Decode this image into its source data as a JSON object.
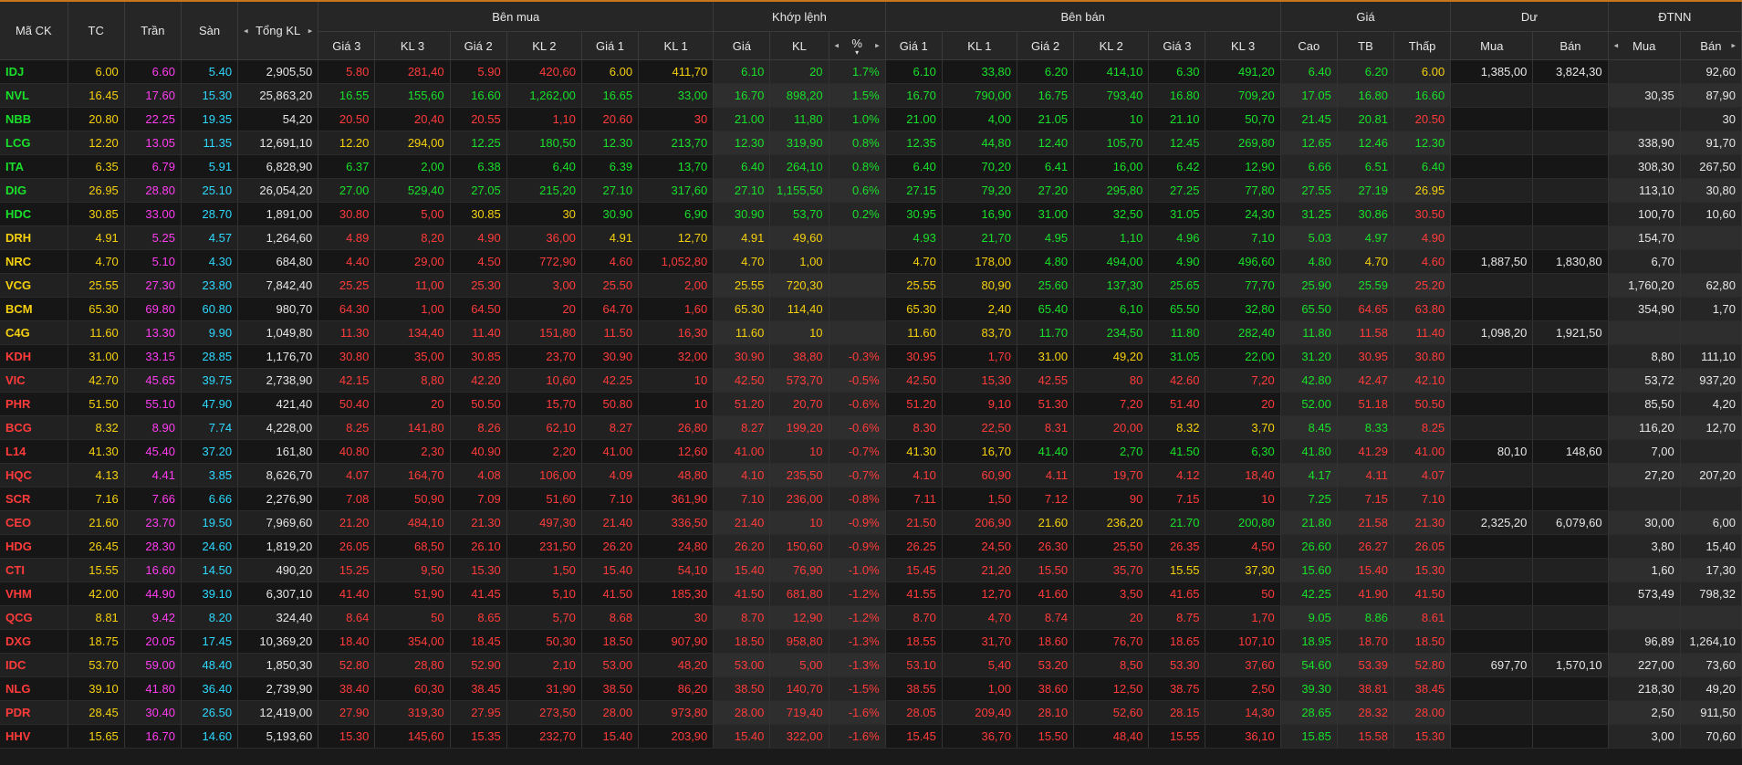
{
  "colors": {
    "up": "#19e02a",
    "down": "#ff3b3b",
    "ref": "#f5d00e",
    "ceil": "#ff3cf0",
    "floor": "#2ed9ff",
    "neutral": "#e6e6e6",
    "accent": "#c9751e"
  },
  "header": {
    "ma_ck": "Mã CK",
    "tc": "TC",
    "tran": "Trần",
    "san": "Sàn",
    "tong_kl": "Tổng KL",
    "ben_mua": "Bên mua",
    "khop_lenh": "Khớp lệnh",
    "ben_ban": "Bên bán",
    "gia": "Giá",
    "du": "Dư",
    "dtnn": "ĐTNN",
    "gia3": "Giá 3",
    "kl3": "KL 3",
    "gia2": "Giá 2",
    "kl2": "KL 2",
    "gia1": "Giá 1",
    "kl1": "KL 1",
    "kl_gia": "Giá",
    "kl_kl": "KL",
    "kl_pct": "%",
    "cao": "Cao",
    "tb": "TB",
    "thap": "Thấp",
    "mua": "Mua",
    "ban": "Bán",
    "arrow_left": "◂",
    "arrow_right": "▸",
    "sort_down": "▾"
  },
  "rows": [
    {
      "s": "IDJ",
      "c": [
        "6.00",
        "6.60",
        "5.40",
        "2,905,50",
        "5.80",
        "281,40",
        "5.90",
        "420,60",
        "6.00",
        "411,70",
        "6.10",
        "20",
        "1.7%",
        "6.10",
        "33,80",
        "6.20",
        "414,10",
        "6.30",
        "491,20",
        "6.40",
        "6.20",
        "6.00",
        "1,385,00",
        "3,824,30",
        "",
        "92,60"
      ],
      "k": "gcpwrrrryyggggggggggggywwwww"
    },
    {
      "s": "NVL",
      "c": [
        "16.45",
        "17.60",
        "15.30",
        "25,863,20",
        "16.55",
        "155,60",
        "16.60",
        "1,262,00",
        "16.65",
        "33,00",
        "16.70",
        "898,20",
        "1.5%",
        "16.70",
        "790,00",
        "16.75",
        "793,40",
        "16.80",
        "709,20",
        "17.05",
        "16.80",
        "16.60",
        "",
        "",
        "30,35",
        "87,90"
      ],
      "k": "gcpwggggggggggggggggggg"
    },
    {
      "s": "NBB",
      "c": [
        "20.80",
        "22.25",
        "19.35",
        "54,20",
        "20.50",
        "20,40",
        "20.55",
        "1,10",
        "20.60",
        "30",
        "21.00",
        "11,80",
        "1.0%",
        "21.00",
        "4,00",
        "21.05",
        "10",
        "21.10",
        "50,70",
        "21.45",
        "20.81",
        "20.50",
        "",
        "",
        "",
        "30"
      ],
      "k": "gcpwrrrrrrggggggggggggr"
    },
    {
      "s": "LCG",
      "c": [
        "12.20",
        "13.05",
        "11.35",
        "12,691,10",
        "12.20",
        "294,00",
        "12.25",
        "180,50",
        "12.30",
        "213,70",
        "12.30",
        "319,90",
        "0.8%",
        "12.35",
        "44,80",
        "12.40",
        "105,70",
        "12.45",
        "269,80",
        "12.65",
        "12.46",
        "12.30",
        "",
        "",
        "338,90",
        "91,70"
      ],
      "k": "gcpwyyggggggggggggggggg"
    },
    {
      "s": "ITA",
      "c": [
        "6.35",
        "6.79",
        "5.91",
        "6,828,90",
        "6.37",
        "2,00",
        "6.38",
        "6,40",
        "6.39",
        "13,70",
        "6.40",
        "264,10",
        "0.8%",
        "6.40",
        "70,20",
        "6.41",
        "16,00",
        "6.42",
        "12,90",
        "6.66",
        "6.51",
        "6.40",
        "",
        "",
        "308,30",
        "267,50"
      ],
      "k": "gcpwggggggggggggggggggg"
    },
    {
      "s": "DIG",
      "c": [
        "26.95",
        "28.80",
        "25.10",
        "26,054,20",
        "27.00",
        "529,40",
        "27.05",
        "215,20",
        "27.10",
        "317,60",
        "27.10",
        "1,155,50",
        "0.6%",
        "27.15",
        "79,20",
        "27.20",
        "295,80",
        "27.25",
        "77,80",
        "27.55",
        "27.19",
        "26.95",
        "",
        "",
        "113,10",
        "30,80"
      ],
      "k": "gcpwggggggggggggggggggy"
    },
    {
      "s": "HDC",
      "c": [
        "30.85",
        "33.00",
        "28.70",
        "1,891,00",
        "30.80",
        "5,00",
        "30.85",
        "30",
        "30.90",
        "6,90",
        "30.90",
        "53,70",
        "0.2%",
        "30.95",
        "16,90",
        "31.00",
        "32,50",
        "31.05",
        "24,30",
        "31.25",
        "30.86",
        "30.50",
        "",
        "",
        "100,70",
        "10,60"
      ],
      "k": "gcpwrryygggggggggggggggr"
    },
    {
      "s": "DRH",
      "c": [
        "4.91",
        "5.25",
        "4.57",
        "1,264,60",
        "4.89",
        "8,20",
        "4.90",
        "36,00",
        "4.91",
        "12,70",
        "4.91",
        "49,60",
        "",
        "4.93",
        "21,70",
        "4.95",
        "1,10",
        "4.96",
        "7,10",
        "5.03",
        "4.97",
        "4.90",
        "",
        "",
        "154,70",
        ""
      ],
      "k": "ycpwrrrryyyyyyggggggggggr"
    },
    {
      "s": "NRC",
      "c": [
        "4.70",
        "5.10",
        "4.30",
        "684,80",
        "4.40",
        "29,00",
        "4.50",
        "772,90",
        "4.60",
        "1,052,80",
        "4.70",
        "1,00",
        "",
        "4.70",
        "178,00",
        "4.80",
        "494,00",
        "4.90",
        "496,60",
        "4.80",
        "4.70",
        "4.60",
        "1,887,50",
        "1,830,80",
        "6,70",
        ""
      ],
      "k": "ycpwrrrrrryyyyyyggggggyr"
    },
    {
      "s": "VCG",
      "c": [
        "25.55",
        "27.30",
        "23.80",
        "7,842,40",
        "25.25",
        "11,00",
        "25.30",
        "3,00",
        "25.50",
        "2,00",
        "25.55",
        "720,30",
        "",
        "25.55",
        "80,90",
        "25.60",
        "137,30",
        "25.65",
        "77,70",
        "25.90",
        "25.59",
        "25.20",
        "",
        "",
        "1,760,20",
        "62,80"
      ],
      "k": "ycpwrrrrrryyyyyygggggggr"
    },
    {
      "s": "BCM",
      "c": [
        "65.30",
        "69.80",
        "60.80",
        "980,70",
        "64.30",
        "1,00",
        "64.50",
        "20",
        "64.70",
        "1,60",
        "65.30",
        "114,40",
        "",
        "65.30",
        "2,40",
        "65.40",
        "6,10",
        "65.50",
        "32,80",
        "65.50",
        "64.65",
        "63.80",
        "",
        "",
        "354,90",
        "1,70"
      ],
      "k": "ycpwrrrrrryyyyyygggggggrr"
    },
    {
      "s": "C4G",
      "c": [
        "11.60",
        "13.30",
        "9.90",
        "1,049,80",
        "11.30",
        "134,40",
        "11.40",
        "151,80",
        "11.50",
        "16,30",
        "11.60",
        "10",
        "",
        "11.60",
        "83,70",
        "11.70",
        "234,50",
        "11.80",
        "282,40",
        "11.80",
        "11.58",
        "11.40",
        "1,098,20",
        "1,921,50",
        "",
        ""
      ],
      "k": "ycpwrrrrrryyyyyygggggggrr"
    },
    {
      "s": "KDH",
      "c": [
        "31.00",
        "33.15",
        "28.85",
        "1,176,70",
        "30.80",
        "35,00",
        "30.85",
        "23,70",
        "30.90",
        "32,00",
        "30.90",
        "38,80",
        "-0.3%",
        "30.95",
        "1,70",
        "31.00",
        "49,20",
        "31.05",
        "22,00",
        "31.20",
        "30.95",
        "30.80",
        "",
        "",
        "8,80",
        "111,10"
      ],
      "k": "rcpwrrrrrrrrrrrryyyyggggrrr"
    },
    {
      "s": "VIC",
      "c": [
        "42.70",
        "45.65",
        "39.75",
        "2,738,90",
        "42.15",
        "8,80",
        "42.20",
        "10,60",
        "42.25",
        "10",
        "42.50",
        "573,70",
        "-0.5%",
        "42.50",
        "15,30",
        "42.55",
        "80",
        "42.60",
        "7,20",
        "42.80",
        "42.47",
        "42.10",
        "",
        "",
        "53,72",
        "937,20"
      ],
      "k": "rcpwrrrrrrrrrrrrrrrrrgrrr"
    },
    {
      "s": "PHR",
      "c": [
        "51.50",
        "55.10",
        "47.90",
        "421,40",
        "50.40",
        "20",
        "50.50",
        "15,70",
        "50.80",
        "10",
        "51.20",
        "20,70",
        "-0.6%",
        "51.20",
        "9,10",
        "51.30",
        "7,20",
        "51.40",
        "20",
        "52.00",
        "51.18",
        "50.50",
        "",
        "",
        "85,50",
        "4,20"
      ],
      "k": "rcpwrrrrrrrrrrrrrrrrrgrrr"
    },
    {
      "s": "BCG",
      "c": [
        "8.32",
        "8.90",
        "7.74",
        "4,228,00",
        "8.25",
        "141,80",
        "8.26",
        "62,10",
        "8.27",
        "26,80",
        "8.27",
        "199,20",
        "-0.6%",
        "8.30",
        "22,50",
        "8.31",
        "20,00",
        "8.32",
        "3,70",
        "8.45",
        "8.33",
        "8.25",
        "",
        "",
        "116,20",
        "12,70"
      ],
      "k": "rcpwrrrrrrrrrrrrrrryyggrrr"
    },
    {
      "s": "L14",
      "c": [
        "41.30",
        "45.40",
        "37.20",
        "161,80",
        "40.80",
        "2,30",
        "40.90",
        "2,20",
        "41.00",
        "12,60",
        "41.00",
        "10",
        "-0.7%",
        "41.30",
        "16,70",
        "41.40",
        "2,70",
        "41.50",
        "6,30",
        "41.80",
        "41.29",
        "41.00",
        "80,10",
        "148,60",
        "7,00",
        ""
      ],
      "k": "rcpwrrrrrrrrrryyggggggrr"
    },
    {
      "s": "HQC",
      "c": [
        "4.13",
        "4.41",
        "3.85",
        "8,626,70",
        "4.07",
        "164,70",
        "4.08",
        "106,00",
        "4.09",
        "48,80",
        "4.10",
        "235,50",
        "-0.7%",
        "4.10",
        "60,90",
        "4.11",
        "19,70",
        "4.12",
        "18,40",
        "4.17",
        "4.11",
        "4.07",
        "",
        "",
        "27,20",
        "207,20"
      ],
      "k": "rcpwrrrrrrrrrrrrrrrrrgrr"
    },
    {
      "s": "SCR",
      "c": [
        "7.16",
        "7.66",
        "6.66",
        "2,276,90",
        "7.08",
        "50,90",
        "7.09",
        "51,60",
        "7.10",
        "361,90",
        "7.10",
        "236,00",
        "-0.8%",
        "7.11",
        "1,50",
        "7.12",
        "90",
        "7.15",
        "10",
        "7.25",
        "7.15",
        "7.10",
        "",
        "",
        "",
        ""
      ],
      "k": "rcpwrrrrrrrrrrrrrrrrrgrr"
    },
    {
      "s": "CEO",
      "c": [
        "21.60",
        "23.70",
        "19.50",
        "7,969,60",
        "21.20",
        "484,10",
        "21.30",
        "497,30",
        "21.40",
        "336,50",
        "21.40",
        "10",
        "-0.9%",
        "21.50",
        "206,90",
        "21.60",
        "236,20",
        "21.70",
        "200,80",
        "21.80",
        "21.58",
        "21.30",
        "2,325,20",
        "6,079,60",
        "30,00",
        "6,00"
      ],
      "k": "rcpwrrrrrrrrrrrrryyggggrr"
    },
    {
      "s": "HDG",
      "c": [
        "26.45",
        "28.30",
        "24.60",
        "1,819,20",
        "26.05",
        "68,50",
        "26.10",
        "231,50",
        "26.20",
        "24,80",
        "26.20",
        "150,60",
        "-0.9%",
        "26.25",
        "24,50",
        "26.30",
        "25,50",
        "26.35",
        "4,50",
        "26.60",
        "26.27",
        "26.05",
        "",
        "",
        "3,80",
        "15,40"
      ],
      "k": "rcpwrrrrrrrrrrrrrrrrrgrr"
    },
    {
      "s": "CTI",
      "c": [
        "15.55",
        "16.60",
        "14.50",
        "490,20",
        "15.25",
        "9,50",
        "15.30",
        "1,50",
        "15.40",
        "54,10",
        "15.40",
        "76,90",
        "-1.0%",
        "15.45",
        "21,20",
        "15.50",
        "35,70",
        "15.55",
        "37,30",
        "15.60",
        "15.40",
        "15.30",
        "",
        "",
        "1,60",
        "17,30"
      ],
      "k": "rcpwrrrrrrrrrrrrrrrryyggrr"
    },
    {
      "s": "VHM",
      "c": [
        "42.00",
        "44.90",
        "39.10",
        "6,307,10",
        "41.40",
        "51,90",
        "41.45",
        "5,10",
        "41.50",
        "185,30",
        "41.50",
        "681,80",
        "-1.2%",
        "41.55",
        "12,70",
        "41.60",
        "3,50",
        "41.65",
        "50",
        "42.25",
        "41.90",
        "41.50",
        "",
        "",
        "573,49",
        "798,32"
      ],
      "k": "rcpwrrrrrrrrrrrrrrrrrgrr"
    },
    {
      "s": "QCG",
      "c": [
        "8.81",
        "9.42",
        "8.20",
        "324,40",
        "8.64",
        "50",
        "8.65",
        "5,70",
        "8.68",
        "30",
        "8.70",
        "12,90",
        "-1.2%",
        "8.70",
        "4,70",
        "8.74",
        "20",
        "8.75",
        "1,70",
        "9.05",
        "8.86",
        "8.61",
        "",
        "",
        "",
        ""
      ],
      "k": "rcpwrrrrrrrrrrrrrrrrrggr"
    },
    {
      "s": "DXG",
      "c": [
        "18.75",
        "20.05",
        "17.45",
        "10,369,20",
        "18.40",
        "354,00",
        "18.45",
        "50,30",
        "18.50",
        "907,90",
        "18.50",
        "958,80",
        "-1.3%",
        "18.55",
        "31,70",
        "18.60",
        "76,70",
        "18.65",
        "107,10",
        "18.95",
        "18.70",
        "18.50",
        "",
        "",
        "96,89",
        "1,264,10"
      ],
      "k": "rcpwrrrrrrrrrrrrrrrrrgrr"
    },
    {
      "s": "IDC",
      "c": [
        "53.70",
        "59.00",
        "48.40",
        "1,850,30",
        "52.80",
        "28,80",
        "52.90",
        "2,10",
        "53.00",
        "48,20",
        "53.00",
        "5,00",
        "-1.3%",
        "53.10",
        "5,40",
        "53.20",
        "8,50",
        "53.30",
        "37,60",
        "54.60",
        "53.39",
        "52.80",
        "697,70",
        "1,570,10",
        "227,00",
        "73,60"
      ],
      "k": "rcpwrrrrrrrrrrrrrrrrrgrr"
    },
    {
      "s": "NLG",
      "c": [
        "39.10",
        "41.80",
        "36.40",
        "2,739,90",
        "38.40",
        "60,30",
        "38.45",
        "31,90",
        "38.50",
        "86,20",
        "38.50",
        "140,70",
        "-1.5%",
        "38.55",
        "1,00",
        "38.60",
        "12,50",
        "38.75",
        "2,50",
        "39.30",
        "38.81",
        "38.45",
        "",
        "",
        "218,30",
        "49,20"
      ],
      "k": "rcpwrrrrrrrrrrrrrrrrrgrr"
    },
    {
      "s": "PDR",
      "c": [
        "28.45",
        "30.40",
        "26.50",
        "12,419,00",
        "27.90",
        "319,30",
        "27.95",
        "273,50",
        "28.00",
        "973,80",
        "28.00",
        "719,40",
        "-1.6%",
        "28.05",
        "209,40",
        "28.10",
        "52,60",
        "28.15",
        "14,30",
        "28.65",
        "28.32",
        "28.00",
        "",
        "",
        "2,50",
        "911,50"
      ],
      "k": "rcpwrrrrrrrrrrrrrrrrrgrr"
    },
    {
      "s": "HHV",
      "c": [
        "15.65",
        "16.70",
        "14.60",
        "5,193,60",
        "15.30",
        "145,60",
        "15.35",
        "232,70",
        "15.40",
        "203,90",
        "15.40",
        "322,00",
        "-1.6%",
        "15.45",
        "36,70",
        "15.50",
        "48,40",
        "15.55",
        "36,10",
        "15.85",
        "15.58",
        "15.30",
        "",
        "",
        "3,00",
        "70,60"
      ],
      "k": "rcpwrrrrrrrrrrrrrrrrrgrr"
    }
  ]
}
